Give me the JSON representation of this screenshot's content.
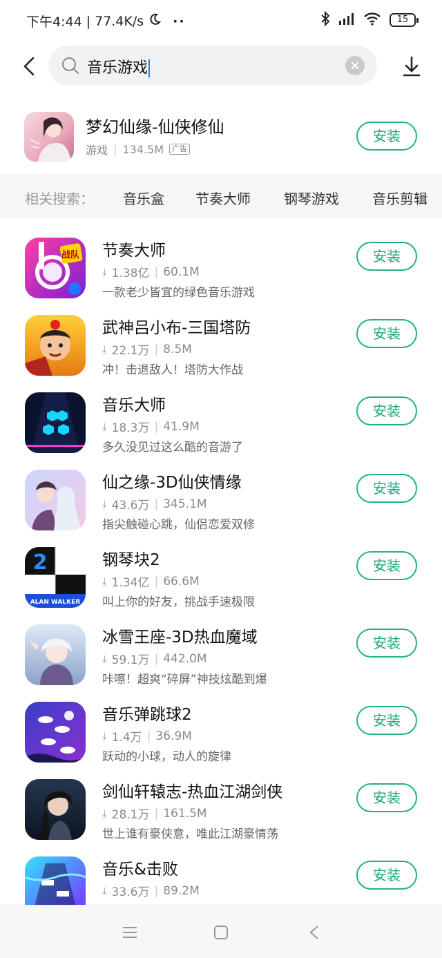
{
  "status_bar": {
    "time": "下午4:44",
    "network_speed": "77.4K/s",
    "icons": [
      "moon-icon",
      "more-dots-icon",
      "bluetooth-icon",
      "signal-icon",
      "wifi-icon"
    ],
    "battery_level": "15"
  },
  "search": {
    "query": "音乐游戏",
    "icons": {
      "back": "back-arrow-icon",
      "search": "search-icon",
      "clear": "clear-icon",
      "download": "download-icon"
    }
  },
  "featured_app": {
    "name": "梦幻仙缘-仙侠修仙",
    "category": "游戏",
    "size": "134.5M",
    "ad_label": "广告",
    "install_label": "安装"
  },
  "related_searches": {
    "label": "相关搜索：",
    "items": [
      "音乐盒",
      "节奏大师",
      "钢琴游戏",
      "音乐剪辑"
    ]
  },
  "apps": [
    {
      "name": "节奏大师",
      "downloads": "1.38亿",
      "size": "60.1M",
      "desc": "一款老少皆宜的绿色音乐游戏",
      "install_label": "安装"
    },
    {
      "name": "武神吕小布-三国塔防",
      "downloads": "22.1万",
      "size": "8.5M",
      "desc": "冲！击退敌人！塔防大作战",
      "install_label": "安装"
    },
    {
      "name": "音乐大师",
      "downloads": "18.3万",
      "size": "41.9M",
      "desc": "多久没见过这么酷的音游了",
      "install_label": "安装"
    },
    {
      "name": "仙之缘-3D仙侠情缘",
      "downloads": "43.6万",
      "size": "345.1M",
      "desc": "指尖触碰心跳，仙侣恋爱双修",
      "install_label": "安装"
    },
    {
      "name": "钢琴块2",
      "downloads": "1.34亿",
      "size": "66.6M",
      "desc": "叫上你的好友，挑战手速极限",
      "install_label": "安装"
    },
    {
      "name": "冰雪王座-3D热血魔域",
      "downloads": "59.1万",
      "size": "442.0M",
      "desc": "咔嚓！超爽“碎屏”神技炫酷到爆",
      "install_label": "安装"
    },
    {
      "name": "音乐弹跳球2",
      "downloads": "1.4万",
      "size": "36.9M",
      "desc": "跃动的小球，动人的旋律",
      "install_label": "安装"
    },
    {
      "name": "剑仙轩辕志-热血江湖剑侠",
      "downloads": "28.1万",
      "size": "161.5M",
      "desc": "世上谁有豪侠意，唯此江湖豪情荡",
      "install_label": "安装"
    },
    {
      "name": "音乐&击败",
      "downloads": "33.6万",
      "size": "89.2M",
      "desc": "",
      "install_label": "安装"
    }
  ],
  "app_icon_badges": {
    "jiezou": "战队",
    "piano": "ALAN WALKER",
    "piano_num": "2"
  },
  "nav_bar": {
    "icons": [
      "menu-icon",
      "home-square-icon",
      "back-triangle-icon"
    ]
  },
  "colors": {
    "accent": "#24b187",
    "install_text": "#1ba67c",
    "related_bg": "#f5f6f7",
    "search_bg": "#f1f2f3"
  }
}
